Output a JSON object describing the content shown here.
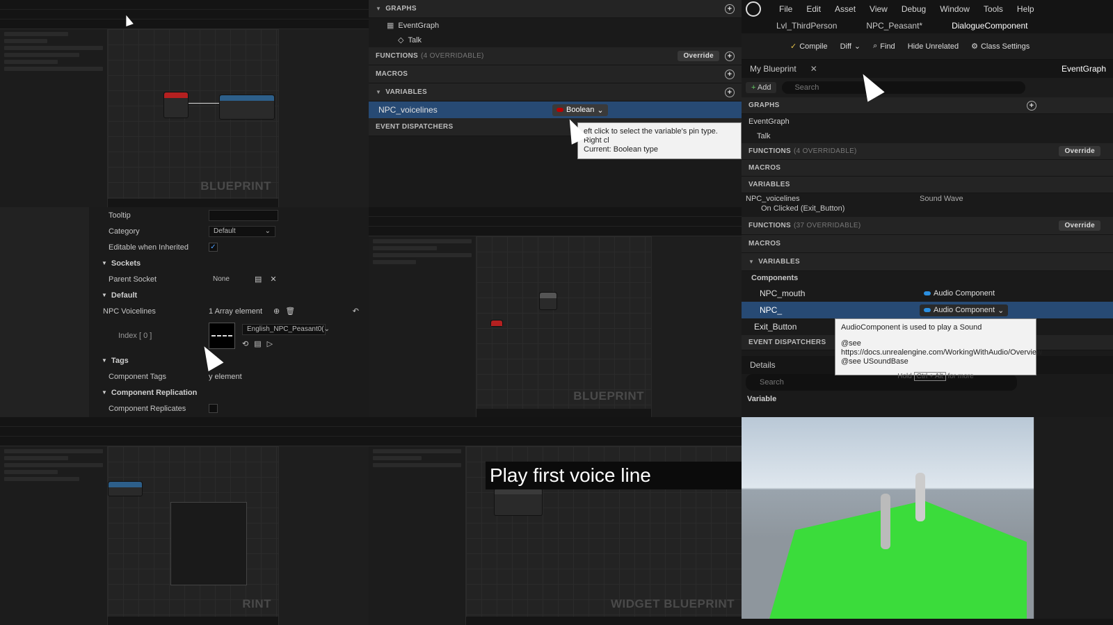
{
  "tile1": {
    "watermark": "BLUEPRINT"
  },
  "tile2": {
    "graphs_label": "GRAPHS",
    "event_graph": "EventGraph",
    "talk": "Talk",
    "functions_label": "FUNCTIONS",
    "functions_count": "(4 OVERRIDABLE)",
    "override": "Override",
    "macros": "MACROS",
    "variables": "VARIABLES",
    "variable_name": "NPC_voicelines",
    "variable_type": "Boolean",
    "event_dispatchers": "EVENT DISPATCHERS",
    "tooltip_line1": "eft click to select the variable's pin type. Right cl",
    "tooltip_line2": "Current: Boolean type"
  },
  "tile3": {
    "menu": [
      "File",
      "Edit",
      "Asset",
      "View",
      "Debug",
      "Window",
      "Tools",
      "Help"
    ],
    "tab_level": "Lvl_ThirdPerson",
    "tab_npc": "NPC_Peasant*",
    "tab_dialogue": "DialogueComponent",
    "toolbar": {
      "compile": "Compile",
      "diff": "Diff",
      "find": "Find",
      "hide_unrelated": "Hide Unrelated",
      "class_settings": "Class Settings"
    },
    "my_blueprint": "My Blueprint",
    "event_graph_tab": "EventGraph",
    "add": "Add",
    "search_placeholder": "Search",
    "graphs": "GRAPHS",
    "event_graph": "EventGraph",
    "talk": "Talk",
    "functions": "FUNCTIONS",
    "functions_count": "(4 OVERRIDABLE)",
    "override": "Override",
    "macros": "MACROS",
    "variables": "VARIABLES",
    "npc_voicelines": "NPC_voicelines",
    "sound_wave": "Sound Wave",
    "on_clicked": "On Clicked (Exit_Button)",
    "functions2_count": "(37 OVERRIDABLE)",
    "components": "Components",
    "npc_mouth": "NPC_mouth",
    "audio_component": "Audio Component",
    "npc_input": "NPC_",
    "exit_button": "Exit_Button",
    "event_dispatchers": "EVENT DISPATCHERS",
    "tip_line1": "AudioComponent is used to play a Sound",
    "tip_line2": "@see https://docs.unrealengine.com/WorkingWithAudio/Overview",
    "tip_line3": "@see USoundBase",
    "tip_hold": "Hold",
    "tip_keys": "Ctrl + Alt",
    "tip_more": "for more",
    "details": "Details",
    "details_search": "Search",
    "variable_cat": "Variable"
  },
  "tile4": {
    "tooltip": "Tooltip",
    "category": "Category",
    "category_value": "Default",
    "editable_inherited": "Editable when Inherited",
    "sockets": "Sockets",
    "parent_socket": "Parent Socket",
    "parent_socket_value": "None",
    "default": "Default",
    "npc_voicelines": "NPC Voicelines",
    "array_elements": "1 Array element",
    "index0": "Index [ 0 ]",
    "asset_name": "English_NPC_Peasant0(",
    "tags": "Tags",
    "component_tags": "Component Tags",
    "component_tags_value": "y element",
    "component_replication": "Component Replication",
    "component_replicates": "Component Replicates"
  },
  "tile5": {
    "watermark": "BLUEPRINT"
  },
  "tile6": {
    "watermark": "RINT"
  },
  "tile7": {
    "caption": "Play first voice line",
    "watermark": "WIDGET BLUEPRINT"
  },
  "colors": {
    "accent": "#274a74",
    "green_floor": "#3bdc3b",
    "audio_blue": "#2b8fe0",
    "bool_red": "#b80000"
  }
}
